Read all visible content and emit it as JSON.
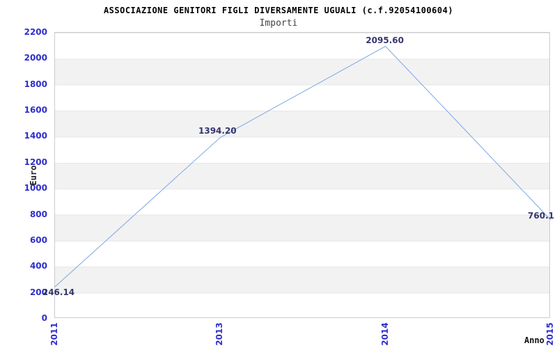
{
  "title": "ASSOCIAZIONE GENITORI FIGLI DIVERSAMENTE UGUALI (c.f.92054100604)",
  "subtitle": "Importi",
  "chart_data": {
    "type": "line",
    "title": "ASSOCIAZIONE GENITORI FIGLI DIVERSAMENTE UGUALI (c.f.92054100604)",
    "subtitle": "Importi",
    "xlabel": "Anno",
    "ylabel": "Euro",
    "x": [
      "2011",
      "2013",
      "2014",
      "2015"
    ],
    "series": [
      {
        "name": "Importi",
        "values": [
          246.14,
          1394.2,
          2095.6,
          760.1
        ]
      }
    ],
    "point_labels": [
      "246.14",
      "1394.20",
      "2095.60",
      "760.1"
    ],
    "ylim": [
      0,
      2200
    ],
    "ytick_step": 200,
    "yticks": [
      "0",
      "200",
      "400",
      "600",
      "800",
      "1000",
      "1200",
      "1400",
      "1600",
      "1800",
      "2000",
      "2200"
    ],
    "grid": "alternating horizontal bands, no vertical gridlines",
    "legend": "none",
    "label_offsets": [
      [
        5,
        8
      ],
      [
        -4,
        -10
      ],
      [
        -1,
        -9
      ],
      [
        -14,
        -6
      ]
    ],
    "colors": {
      "line": "#7ba7e3",
      "tick_label": "#2e2ecd",
      "point_label": "#35356f",
      "band": "#f2f2f2",
      "plot_border": "#cccccc",
      "title": "#000000",
      "subtitle": "#444444",
      "axis_title": "#222222"
    }
  }
}
